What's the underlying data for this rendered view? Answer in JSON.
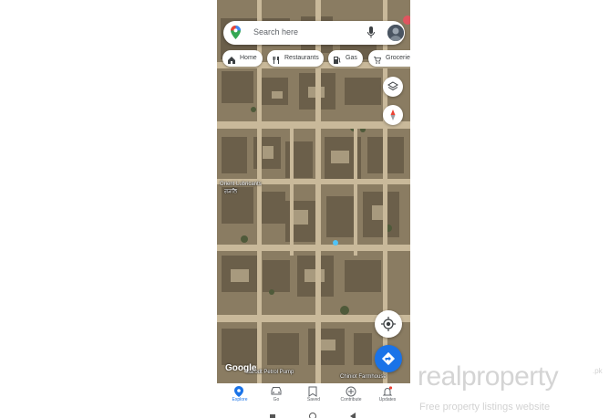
{
  "search": {
    "placeholder": "Search here"
  },
  "chips": [
    {
      "label": "Home",
      "icon": "home-icon"
    },
    {
      "label": "Restaurants",
      "icon": "fork-knife-icon"
    },
    {
      "label": "Gas",
      "icon": "gas-pump-icon"
    },
    {
      "label": "Groceries",
      "icon": "cart-icon"
    }
  ],
  "map": {
    "labels": {
      "oriental_lubricants": "Orient Lubricants",
      "oriental_sub": "ਗੜਲਿ",
      "petrol_pump": "Sarodt Petrol Pump",
      "chiniot": "Chiniot Farmhouse"
    },
    "brand": "Google",
    "colors": {
      "ground": "#8a7c62",
      "road": "#c9b99a",
      "accent": "#1a73e8"
    }
  },
  "bottom_nav": [
    {
      "label": "Explore",
      "icon": "explore-pin-icon",
      "active": true
    },
    {
      "label": "Go",
      "icon": "car-icon",
      "active": false
    },
    {
      "label": "Saved",
      "icon": "bookmark-icon",
      "active": false
    },
    {
      "label": "Contribute",
      "icon": "plus-circle-icon",
      "active": false
    },
    {
      "label": "Updates",
      "icon": "bell-icon",
      "active": false
    }
  ],
  "watermark": {
    "brand": "realproperty",
    "suffix": ".pk",
    "tagline": "Free property listings website"
  }
}
